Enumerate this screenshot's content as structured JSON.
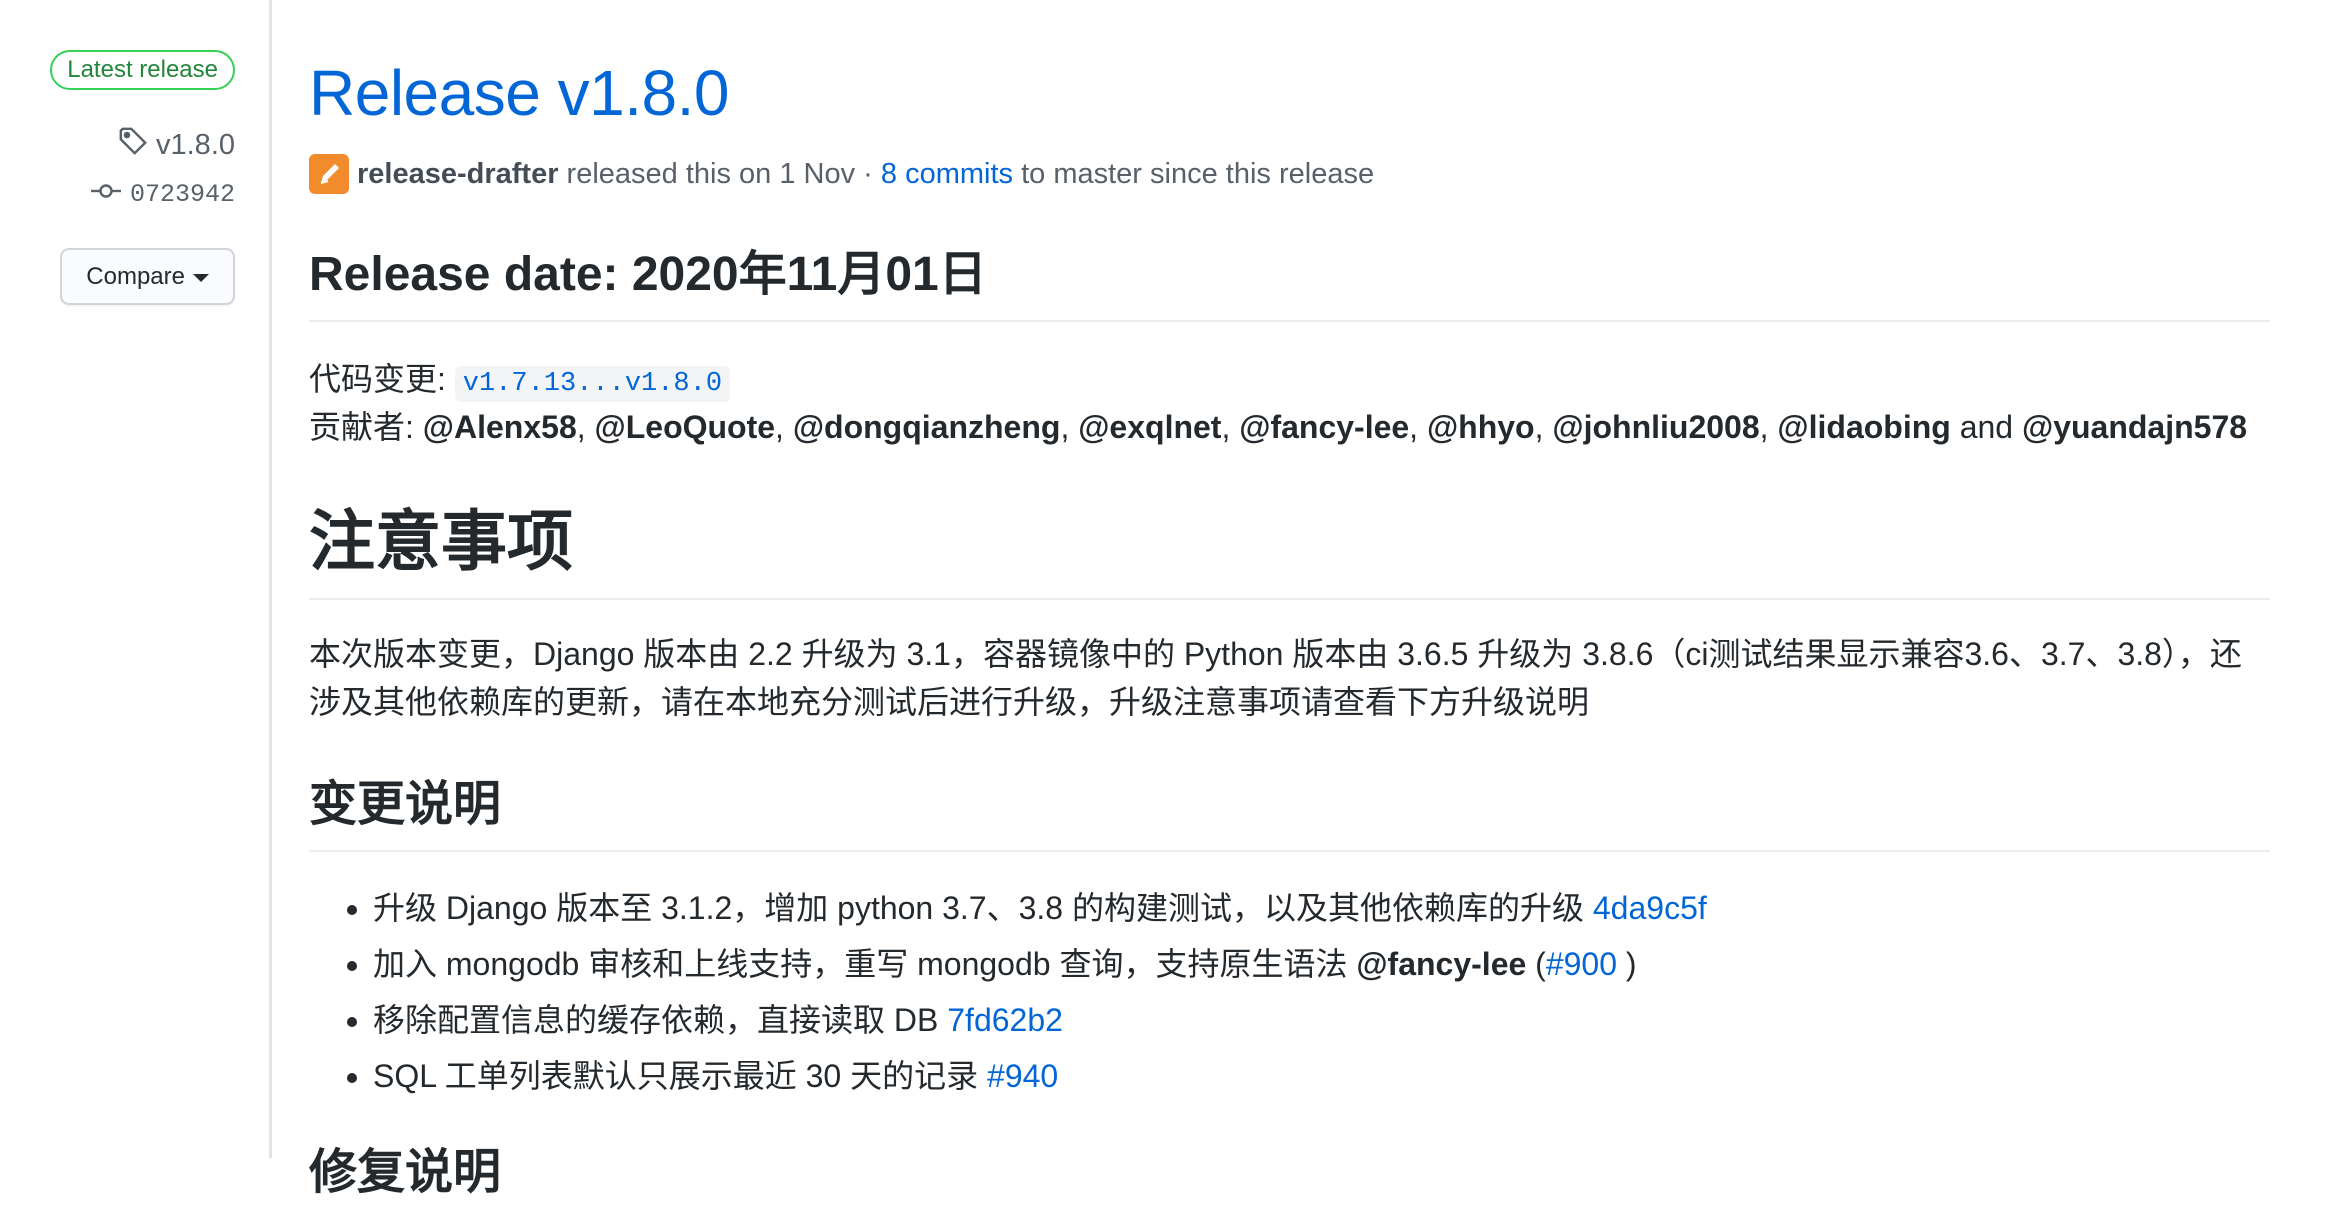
{
  "sidebar": {
    "latest_badge": "Latest release",
    "tag": "v1.8.0",
    "commit": "0723942",
    "compare_label": "Compare"
  },
  "release": {
    "title": "Release v1.8.0",
    "author": "release-drafter",
    "released_text": " released this on 1 Nov · ",
    "commits_link": "8 commits",
    "since_text": " to master since this release"
  },
  "body": {
    "date_heading": "Release date: 2020年11月01日",
    "code_change_label": "代码变更: ",
    "code_change_value": "v1.7.13...v1.8.0",
    "contributors_label": "贡献者: ",
    "contributors": [
      "@Alenx58",
      "@LeoQuote",
      "@dongqianzheng",
      "@exqlnet",
      "@fancy-lee",
      "@hhyo",
      "@johnliu2008",
      "@lidaobing",
      "@yuandajn578"
    ],
    "contributors_sep": ", ",
    "contributors_and": " and ",
    "notice_heading": "注意事项",
    "notice_line1": "本次版本变更，Django 版本由 2.2 升级为 3.1，容器镜像中的 Python 版本由 3.6.5 升级为 3.8.6（ci测试结果显示兼容3.6、3.7、3.8），还",
    "notice_line2": "涉及其他依赖库的更新，请在本地充分测试后进行升级，升级注意事项请查看下方升级说明",
    "changes_heading": "变更说明",
    "changes": [
      {
        "text": "升级 Django 版本至 3.1.2，增加 python 3.7、3.8 的构建测试，以及其他依赖库的升级 ",
        "link": "4da9c5f"
      },
      {
        "text": "加入 mongodb 审核和上线支持，重写 mongodb 查询，支持原生语法 ",
        "mention": "@fancy-lee",
        "pre": " (",
        "link": "#900",
        "post": " )"
      },
      {
        "text": "移除配置信息的缓存依赖，直接读取 DB ",
        "link": "7fd62b2"
      },
      {
        "text": "SQL 工单列表默认只展示最近 30 天的记录 ",
        "link": "#940"
      }
    ],
    "fix_heading": "修复说明"
  }
}
